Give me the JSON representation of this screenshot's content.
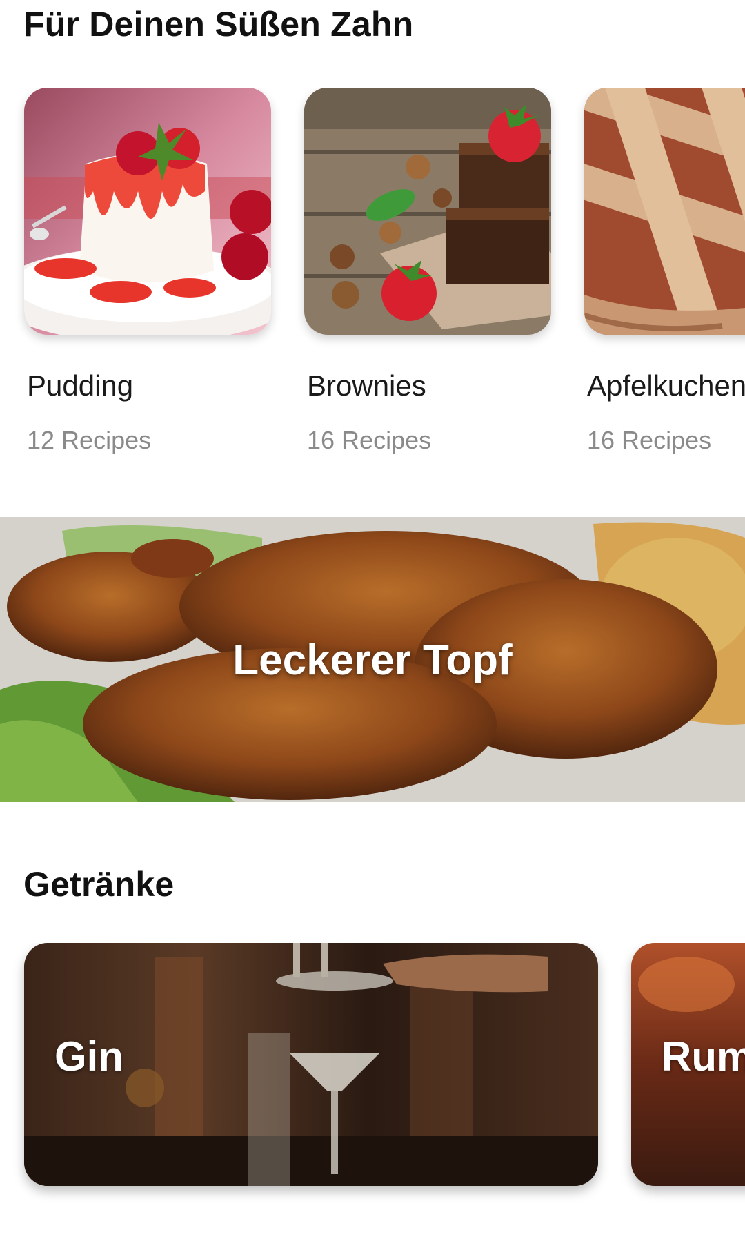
{
  "sections": {
    "sweet": {
      "title": "Für Deinen Süßen Zahn",
      "cards": [
        {
          "name": "Pudding",
          "count": "12 Recipes",
          "image": "panna-cotta-with-raspberries-photo"
        },
        {
          "name": "Brownies",
          "count": "16 Recipes",
          "image": "brownies-with-strawberries-photo"
        },
        {
          "name": "Apfelkuchen",
          "count": "16 Recipes",
          "image": "lattice-apple-pie-photo"
        }
      ]
    },
    "banner": {
      "title": "Leckerer Topf",
      "image": "roasted-chicken-drumsticks-photo"
    },
    "drinks": {
      "title": "Getränke",
      "cards": [
        {
          "label": "Gin",
          "image": "cocktail-being-strained-photo"
        },
        {
          "label": "Rum",
          "image": "rum-drinks-bar-photo"
        }
      ]
    }
  },
  "colors": {
    "background": "#ffffff",
    "title_text": "#111111",
    "count_text": "#8a8a8a",
    "overlay_text": "#ffffff"
  }
}
